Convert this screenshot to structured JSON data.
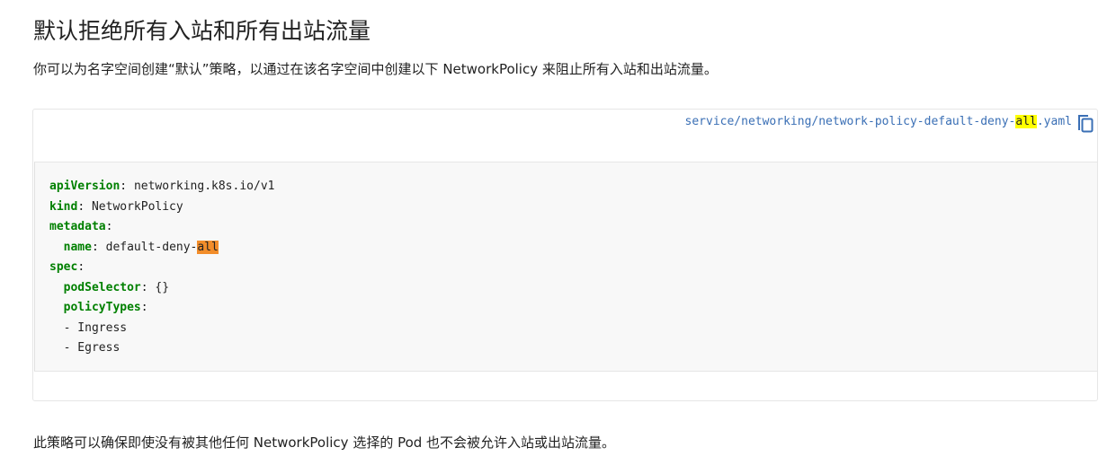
{
  "heading": "默认拒绝所有入站和所有出站流量",
  "intro": "你可以为名字空间创建“默认”策略，以通过在该名字空间中创建以下 NetworkPolicy 来阻止所有入站和出站流量。",
  "code_file": {
    "prefix": "service/networking/network-policy-default-deny-",
    "highlight": "all",
    "suffix": ".yaml",
    "copy_icon": "copy-icon"
  },
  "code": {
    "lines": [
      {
        "key": "apiVersion",
        "sep": ": ",
        "value": "networking.k8s.io/v1"
      },
      {
        "key": "kind",
        "sep": ": ",
        "value": "NetworkPolicy"
      },
      {
        "key": "metadata",
        "sep": ":",
        "value": ""
      },
      {
        "indent": "  ",
        "key": "name",
        "sep": ": ",
        "value": "default-deny-",
        "highlight": "all"
      },
      {
        "key": "spec",
        "sep": ":",
        "value": ""
      },
      {
        "indent": "  ",
        "key": "podSelector",
        "sep": ": ",
        "value": "{}"
      },
      {
        "indent": "  ",
        "key": "policyTypes",
        "sep": ":",
        "value": ""
      },
      {
        "indent": "  ",
        "key": "",
        "sep": "",
        "value": "- Ingress"
      },
      {
        "indent": "  ",
        "key": "",
        "sep": "",
        "value": "- Egress"
      }
    ]
  },
  "outro": "此策略可以确保即使没有被其他任何 NetworkPolicy 选择的 Pod 也不会被允许入站或出站流量。",
  "colors": {
    "link": "#3a6fb5",
    "yaml_key": "#008000",
    "search_highlight": "#ffff00",
    "current_highlight": "#f28d2a",
    "code_bg": "#f8f8f8"
  }
}
